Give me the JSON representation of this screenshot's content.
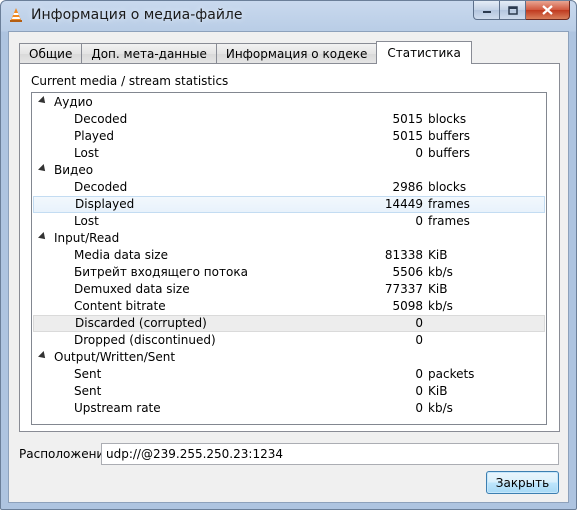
{
  "window": {
    "title": "Информация о медиа-файле"
  },
  "tabs": [
    {
      "label": "Общие"
    },
    {
      "label": "Доп. мета-данные"
    },
    {
      "label": "Информация о кодеке"
    },
    {
      "label": "Статистика",
      "active": true
    }
  ],
  "stats": {
    "caption": "Current media / stream statistics",
    "audio": {
      "label": "Аудио",
      "rows": [
        {
          "name": "Decoded",
          "value": "5015",
          "unit": "blocks"
        },
        {
          "name": "Played",
          "value": "5015",
          "unit": "buffers"
        },
        {
          "name": "Lost",
          "value": "0",
          "unit": "buffers"
        }
      ]
    },
    "video": {
      "label": "Видео",
      "rows": [
        {
          "name": "Decoded",
          "value": "2986",
          "unit": "blocks"
        },
        {
          "name": "Displayed",
          "value": "14449",
          "unit": "frames"
        },
        {
          "name": "Lost",
          "value": "0",
          "unit": "frames"
        }
      ]
    },
    "input": {
      "label": "Input/Read",
      "rows": [
        {
          "name": "Media data size",
          "value": "81338",
          "unit": "KiB"
        },
        {
          "name": "Битрейт входящего потока",
          "value": "5506",
          "unit": "kb/s"
        },
        {
          "name": "Demuxed data size",
          "value": "77337",
          "unit": "KiB"
        },
        {
          "name": "Content bitrate",
          "value": "5098",
          "unit": "kb/s"
        },
        {
          "name": "Discarded (corrupted)",
          "value": "0",
          "unit": ""
        },
        {
          "name": "Dropped (discontinued)",
          "value": "0",
          "unit": ""
        }
      ]
    },
    "output": {
      "label": "Output/Written/Sent",
      "rows": [
        {
          "name": "Sent",
          "value": "0",
          "unit": "packets"
        },
        {
          "name": "Sent",
          "value": "0",
          "unit": "KiB"
        },
        {
          "name": "Upstream rate",
          "value": "0",
          "unit": "kb/s"
        }
      ]
    }
  },
  "location": {
    "label": "Расположение:",
    "value": "udp://@239.255.250.23:1234"
  },
  "buttons": {
    "close": "Закрыть"
  },
  "colors": {
    "selected_row": "#e8f2fb",
    "button_accent": "#3c7fb1"
  }
}
